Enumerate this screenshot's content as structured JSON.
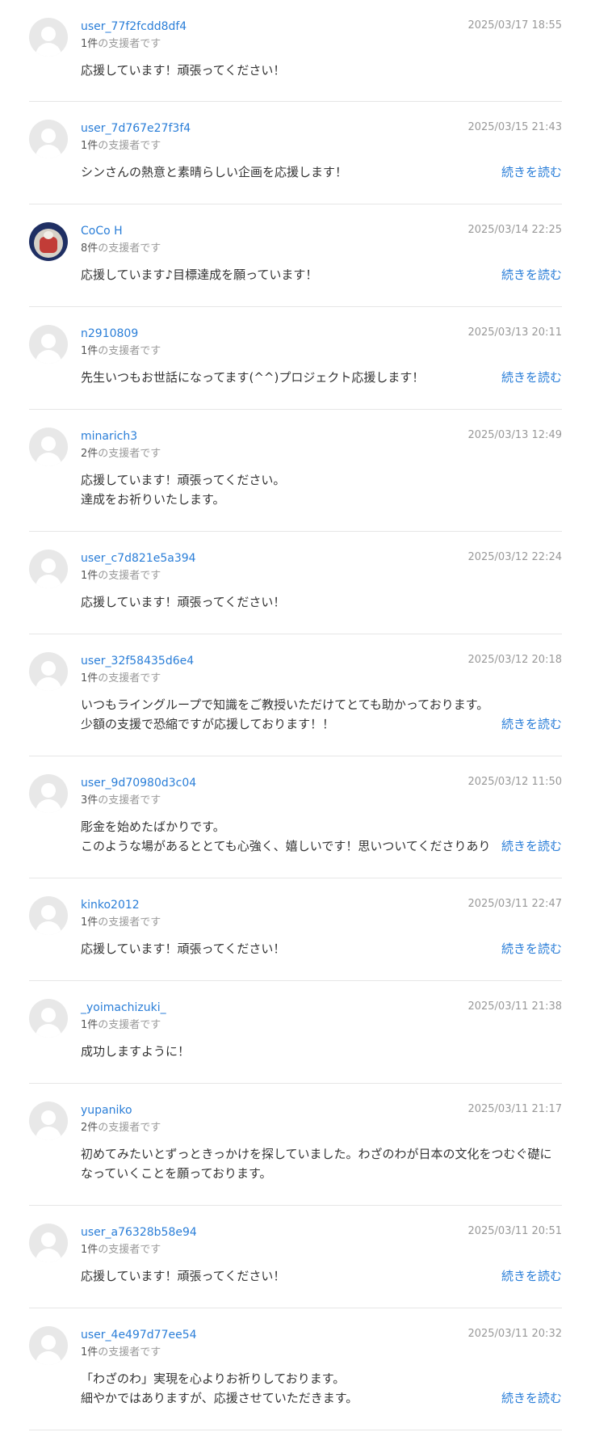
{
  "comments": [
    {
      "name": "user_77f2fcdd8df4",
      "count": "1件",
      "count_suffix": "の支援者です",
      "date": "2025/03/17 18:55",
      "text": "応援しています！頑張ってください！",
      "more": ""
    },
    {
      "name": "user_7d767e27f3f4",
      "count": "1件",
      "count_suffix": "の支援者です",
      "date": "2025/03/15 21:43",
      "text": "シンさんの熱意と素晴らしい企画を応援します！",
      "more": "続きを読む"
    },
    {
      "name": "CoCo H",
      "count": "8件",
      "count_suffix": "の支援者です",
      "date": "2025/03/14 22:25",
      "text": "応援しています♪目標達成を願っています！",
      "more": "続きを読む"
    },
    {
      "name": "n2910809",
      "count": "1件",
      "count_suffix": "の支援者です",
      "date": "2025/03/13 20:11",
      "text": "先生いつもお世話になってます(^^)プロジェクト応援します！",
      "more": "続きを読む"
    },
    {
      "name": "minarich3",
      "count": "2件",
      "count_suffix": "の支援者です",
      "date": "2025/03/13 12:49",
      "text": "応援しています！頑張ってください。\n達成をお祈りいたします。",
      "more": ""
    },
    {
      "name": "user_c7d821e5a394",
      "count": "1件",
      "count_suffix": "の支援者です",
      "date": "2025/03/12 22:24",
      "text": "応援しています！頑張ってください！",
      "more": ""
    },
    {
      "name": "user_32f58435d6e4",
      "count": "1件",
      "count_suffix": "の支援者です",
      "date": "2025/03/12 20:18",
      "text": "いつもライングループで知識をご教授いただけてとても助かっております。\n少額の支援で恐縮ですが応援しております！！",
      "more": "続きを読む"
    },
    {
      "name": "user_9d70980d3c04",
      "count": "3件",
      "count_suffix": "の支援者です",
      "date": "2025/03/12 11:50",
      "text": "彫金を始めたばかりです。\nこのような場があるととても心強く、嬉しいです！思いついてくださりあり",
      "more": "続きを読む"
    },
    {
      "name": "kinko2012",
      "count": "1件",
      "count_suffix": "の支援者です",
      "date": "2025/03/11 22:47",
      "text": "応援しています！頑張ってください！",
      "more": "続きを読む"
    },
    {
      "name": "_yoimachizuki_",
      "count": "1件",
      "count_suffix": "の支援者です",
      "date": "2025/03/11 21:38",
      "text": "成功しますように！",
      "more": ""
    },
    {
      "name": "yupaniko",
      "count": "2件",
      "count_suffix": "の支援者です",
      "date": "2025/03/11 21:17",
      "text": "初めてみたいとずっときっかけを探していました。わざのわが日本の文化をつむぐ礎に\nなっていくことを願っております。",
      "more": ""
    },
    {
      "name": "user_a76328b58e94",
      "count": "1件",
      "count_suffix": "の支援者です",
      "date": "2025/03/11 20:51",
      "text": "応援しています！頑張ってください！",
      "more": "続きを読む"
    },
    {
      "name": "user_4e497d77ee54",
      "count": "1件",
      "count_suffix": "の支援者です",
      "date": "2025/03/11 20:32",
      "text": "「わざのわ」実現を心よりお祈りしております。\n細やかではありますが、応援させていただきます。",
      "more": "続きを読む"
    }
  ],
  "colors": {
    "link": "#2a7ed8",
    "muted": "#999999",
    "divider": "#e6e6e6"
  },
  "icons": {
    "default_avatar": "user-silhouette-icon",
    "photo_avatar": "profile-photo"
  }
}
